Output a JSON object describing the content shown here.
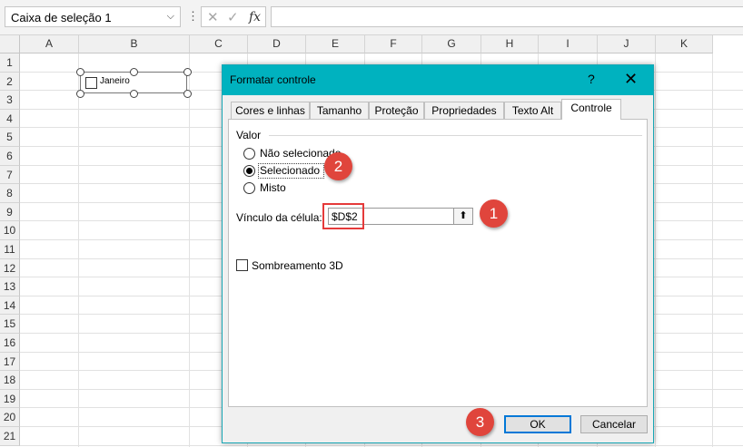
{
  "formula_bar": {
    "name_box": "Caixa de seleção 1",
    "cancel_glyph": "✕",
    "confirm_glyph": "✓",
    "fx_label": "fx",
    "content": ""
  },
  "sheet": {
    "columns": [
      "A",
      "B",
      "C",
      "D",
      "E",
      "F",
      "G",
      "H",
      "I",
      "J",
      "K"
    ],
    "rows": [
      "1",
      "2",
      "3",
      "4",
      "5",
      "6",
      "7",
      "8",
      "9",
      "10",
      "11",
      "12",
      "13",
      "14",
      "15",
      "16",
      "17",
      "18",
      "19",
      "20",
      "21"
    ],
    "checkbox_control": {
      "label": "Janeiro",
      "checked": false
    }
  },
  "dialog": {
    "title": "Formatar controle",
    "help": "?",
    "close": "✕",
    "tabs": [
      "Cores e linhas",
      "Tamanho",
      "Proteção",
      "Propriedades",
      "Texto Alt",
      "Controle"
    ],
    "active_tab": "Controle",
    "value_group": {
      "label": "Valor",
      "options": [
        {
          "label": "Não selecionado",
          "selected": false
        },
        {
          "label": "Selecionado",
          "selected": true
        },
        {
          "label": "Misto",
          "selected": false
        }
      ]
    },
    "cell_link": {
      "label": "Vínculo da célula:",
      "value": "$D$2",
      "button_glyph": "⬆"
    },
    "shading": {
      "label": "Sombreamento 3D",
      "checked": false
    },
    "ok_label": "OK",
    "cancel_label": "Cancelar"
  },
  "annotations": [
    "1",
    "2",
    "3"
  ],
  "colors": {
    "title_bar": "#00b2bf",
    "badge": "#e0453c",
    "highlight": "#e53a3a"
  }
}
